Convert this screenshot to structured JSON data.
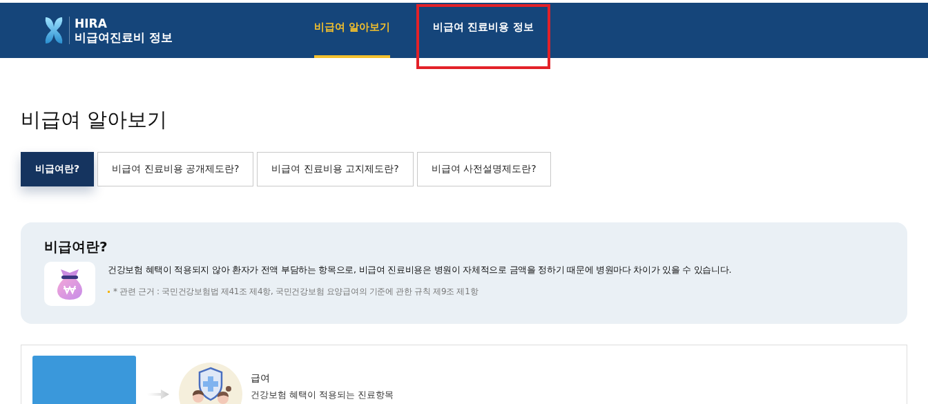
{
  "header": {
    "logo_top": "HIRA",
    "logo_bottom": "비급여진료비 정보",
    "nav": [
      {
        "label": "비급여 알아보기",
        "selected": true,
        "highlighted": false
      },
      {
        "label": "비급여 진료비용 정보",
        "selected": false,
        "highlighted": true
      }
    ]
  },
  "page_title": "비급여 알아보기",
  "tabs": [
    {
      "label": "비급여란?",
      "selected": true
    },
    {
      "label": "비급여 진료비용 공개제도란?",
      "selected": false
    },
    {
      "label": "비급여 진료비용 고지제도란?",
      "selected": false
    },
    {
      "label": "비급여 사전설명제도란?",
      "selected": false
    }
  ],
  "info": {
    "title": "비급여란?",
    "description": "건강보험 혜택이 적용되지 않아 환자가 전액 부담하는 항목으로, 비급여 진료비용은 병원이 자체적으로 금액을 정하기 때문에 병원마다 차이가 있을 수 있습니다.",
    "note": "* 관련 근거 : 국민건강보험법 제41조 제4항, 국민건강보험 요양급여의 기준에 관한 규칙 제9조 제1항"
  },
  "diagram": {
    "item_title": "급여",
    "item_text": "건강보험 혜택이 적용되는 진료항목"
  }
}
